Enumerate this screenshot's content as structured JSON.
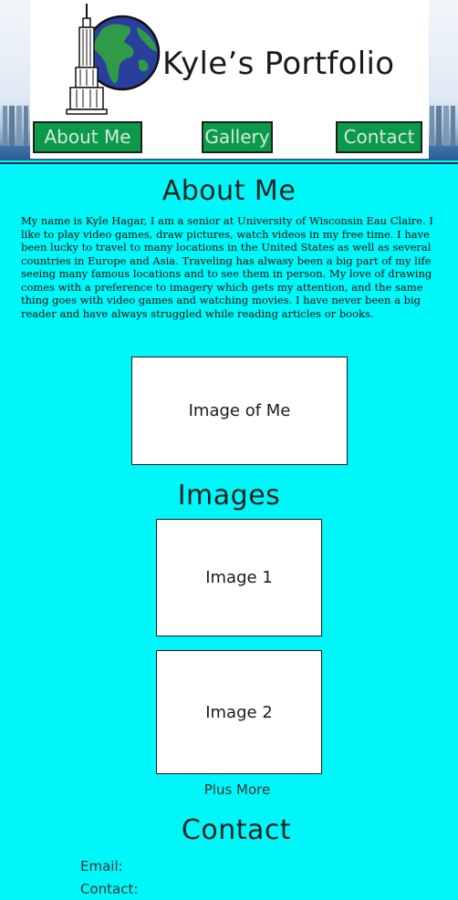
{
  "header": {
    "site_title": "Kyle’s Portfolio",
    "logo_icon": "empire-state-globe-icon"
  },
  "nav": {
    "about": "About Me",
    "gallery": "Gallery",
    "contact": "Contact"
  },
  "about": {
    "heading": "About Me",
    "paragraph": "My name is Kyle Hagar, I am a senior at University of Wisconsin Eau Claire. I like to play video games, draw pictures, watch videos in my free time. I have been lucky to travel to many locations in the United States as well as several countries in Europe and Asia. Traveling has alwasy been a big part of my life seeing many famous locations and to see them in person. My love of drawing comes with a preference to imagery which gets my attention, and the same thing goes with video games and watching movies. I have never been a big reader and have always struggled while reading articles or books.",
    "image_placeholder": "Image of Me"
  },
  "images": {
    "heading": "Images",
    "items": [
      "Image 1",
      "Image 2"
    ],
    "more": "Plus More"
  },
  "contact": {
    "heading": "Contact",
    "email_label": "Email:",
    "contact_label": "Contact:"
  },
  "colors": {
    "background": "#00f7f9",
    "nav_button": "#0a9a4a"
  }
}
